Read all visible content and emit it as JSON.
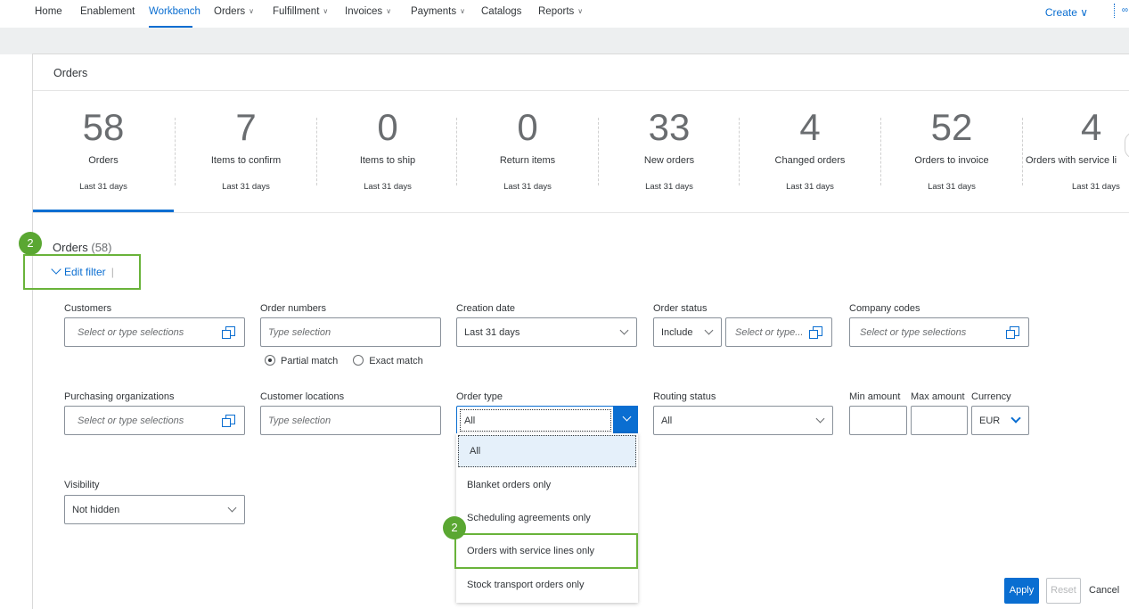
{
  "nav": {
    "items": [
      {
        "label": "Home"
      },
      {
        "label": "Enablement"
      },
      {
        "label": "Workbench",
        "active": true
      },
      {
        "label": "Orders",
        "caret": true
      },
      {
        "label": "Fulfillment",
        "caret": true
      },
      {
        "label": "Invoices",
        "caret": true
      },
      {
        "label": "Payments",
        "caret": true
      },
      {
        "label": "Catalogs"
      },
      {
        "label": "Reports",
        "caret": true
      }
    ],
    "caret_glyph": "∨",
    "create_label": "Create ∨",
    "more_glyph": "∞"
  },
  "panel_title": "Orders",
  "tiles": [
    {
      "num": "58",
      "label": "Orders",
      "sub": "Last 31 days",
      "active": true
    },
    {
      "num": "7",
      "label": "Items to confirm",
      "sub": "Last 31 days"
    },
    {
      "num": "0",
      "label": "Items to ship",
      "sub": "Last 31 days"
    },
    {
      "num": "0",
      "label": "Return items",
      "sub": "Last 31 days"
    },
    {
      "num": "33",
      "label": "New orders",
      "sub": "Last 31 days"
    },
    {
      "num": "4",
      "label": "Changed orders",
      "sub": "Last 31 days"
    },
    {
      "num": "52",
      "label": "Orders to invoice",
      "sub": "Last 31 days"
    },
    {
      "num": "4",
      "label": "Orders with service li",
      "sub": "Last 31 days"
    }
  ],
  "orders_section": {
    "title": "Orders",
    "count": "(58)",
    "edit_filter": "Edit filter",
    "divider": "|"
  },
  "callouts": {
    "badge_1": "2",
    "badge_2": "2"
  },
  "filters": {
    "customers": {
      "label": "Customers",
      "placeholder": "Select or type selections"
    },
    "order_numbers": {
      "label": "Order numbers",
      "placeholder": "Type selection",
      "partial": "Partial match",
      "exact": "Exact match"
    },
    "creation_date": {
      "label": "Creation date",
      "value": "Last 31 days"
    },
    "order_status": {
      "label": "Order status",
      "include": "Include",
      "placeholder": "Select or type..."
    },
    "company_codes": {
      "label": "Company codes",
      "placeholder": "Select or type selections"
    },
    "purchasing_orgs": {
      "label": "Purchasing organizations",
      "placeholder": "Select or type selections"
    },
    "customer_locations": {
      "label": "Customer locations",
      "placeholder": "Type selection"
    },
    "order_type": {
      "label": "Order type",
      "value": "All"
    },
    "routing_status": {
      "label": "Routing status",
      "value": "All"
    },
    "min_amount": {
      "label": "Min amount"
    },
    "max_amount": {
      "label": "Max amount"
    },
    "currency": {
      "label": "Currency",
      "value": "EUR"
    },
    "visibility": {
      "label": "Visibility",
      "value": "Not hidden"
    }
  },
  "order_type_options": [
    {
      "label": "All",
      "selected": true
    },
    {
      "label": "Blanket orders only"
    },
    {
      "label": "Scheduling agreements only"
    },
    {
      "label": "Orders with service lines only"
    },
    {
      "label": "Stock transport orders only"
    }
  ],
  "buttons": {
    "apply": "Apply",
    "reset": "Reset",
    "cancel": "Cancel"
  },
  "colors": {
    "accent": "#0a6ed1",
    "callout": "#69b33a",
    "badge": "#5aa732"
  }
}
